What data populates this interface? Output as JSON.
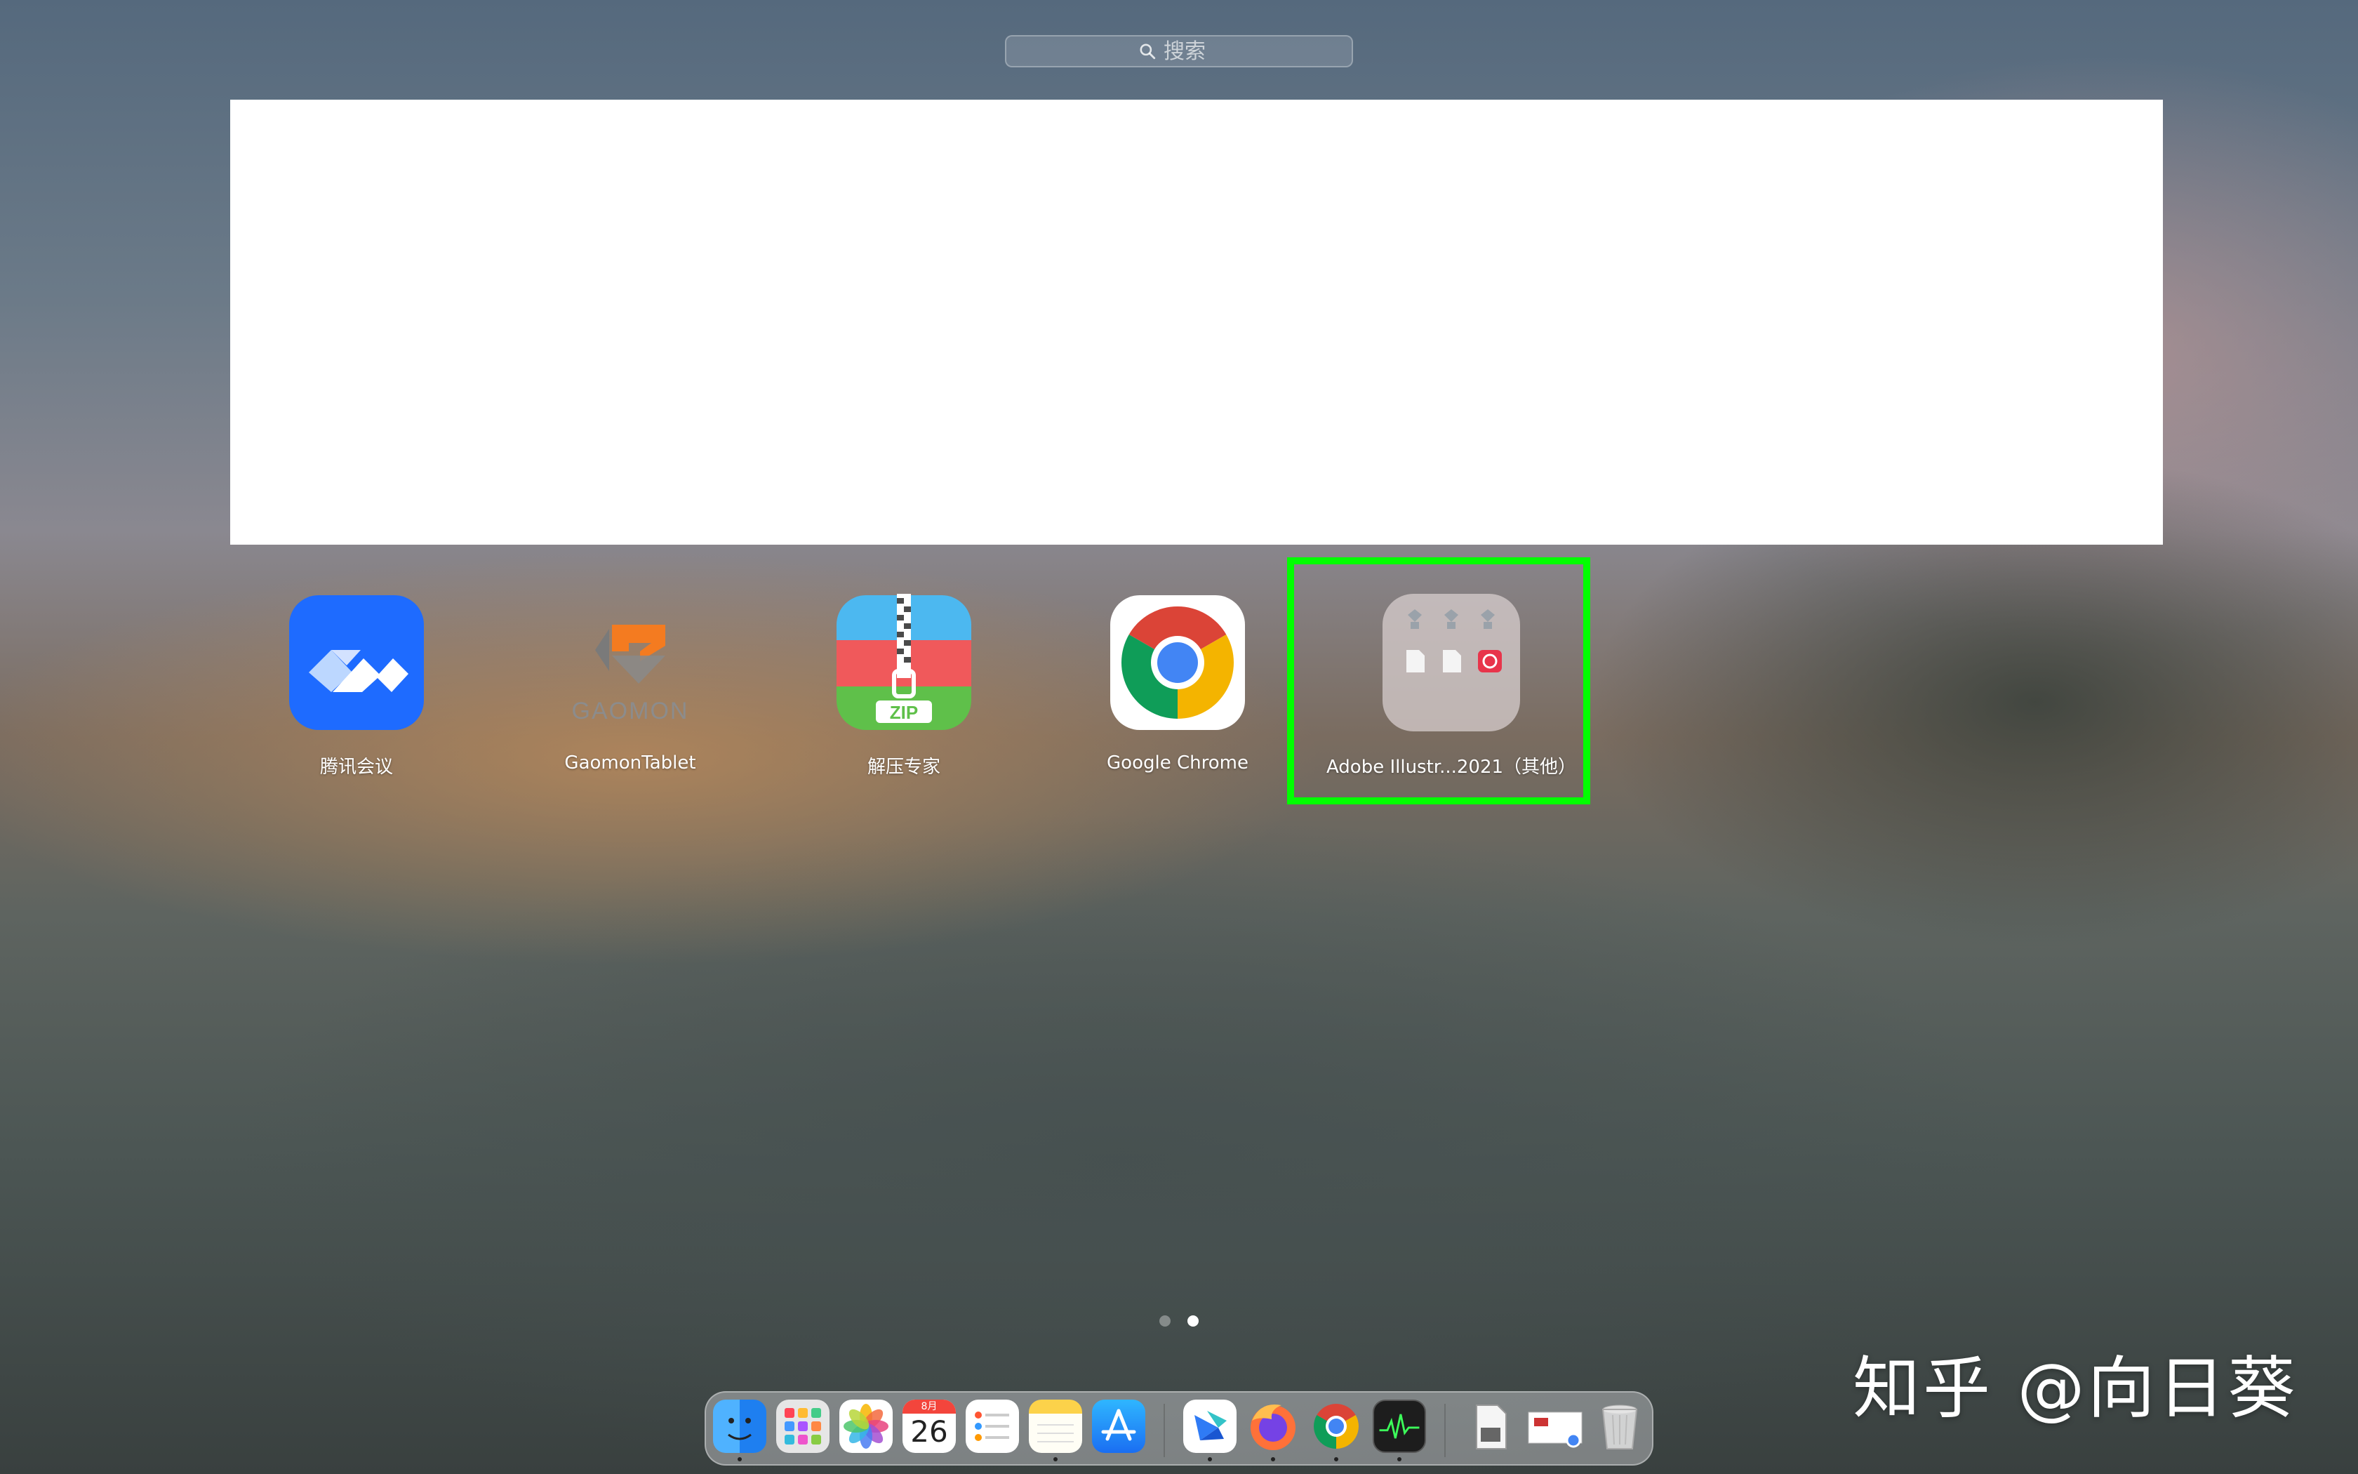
{
  "search": {
    "placeholder": "搜索"
  },
  "apps": [
    {
      "label": "腾讯会议",
      "icon": "tencent-meeting-icon"
    },
    {
      "label": "GaomonTablet",
      "icon": "gaomon-icon",
      "logo_text": "GAOMON"
    },
    {
      "label": "解压专家",
      "icon": "zip-archive-icon",
      "logo_text": "ZIP"
    },
    {
      "label": "Google Chrome",
      "icon": "chrome-icon"
    },
    {
      "label": "Adobe Illustr...2021（其他）",
      "icon": "folder-icon"
    }
  ],
  "pager": {
    "pages": 2,
    "current": 2
  },
  "dock": {
    "calendar_month": "8月",
    "calendar_day": "26",
    "items": [
      "finder-icon",
      "launchpad-icon",
      "photos-icon",
      "calendar-icon",
      "reminders-icon",
      "notes-icon",
      "app-store-icon",
      "feishu-icon",
      "firefox-icon",
      "chrome-icon",
      "activity-monitor-icon",
      "document-icon",
      "screenshot-icon",
      "trash-icon"
    ]
  },
  "watermark": "知乎 @向日葵",
  "colors": {
    "highlight": "#00ff00",
    "tencent_blue": "#1e6bff",
    "chrome_red": "#db4437",
    "chrome_green": "#0f9d58",
    "chrome_yellow": "#f4b400",
    "chrome_blue": "#4285f4"
  }
}
